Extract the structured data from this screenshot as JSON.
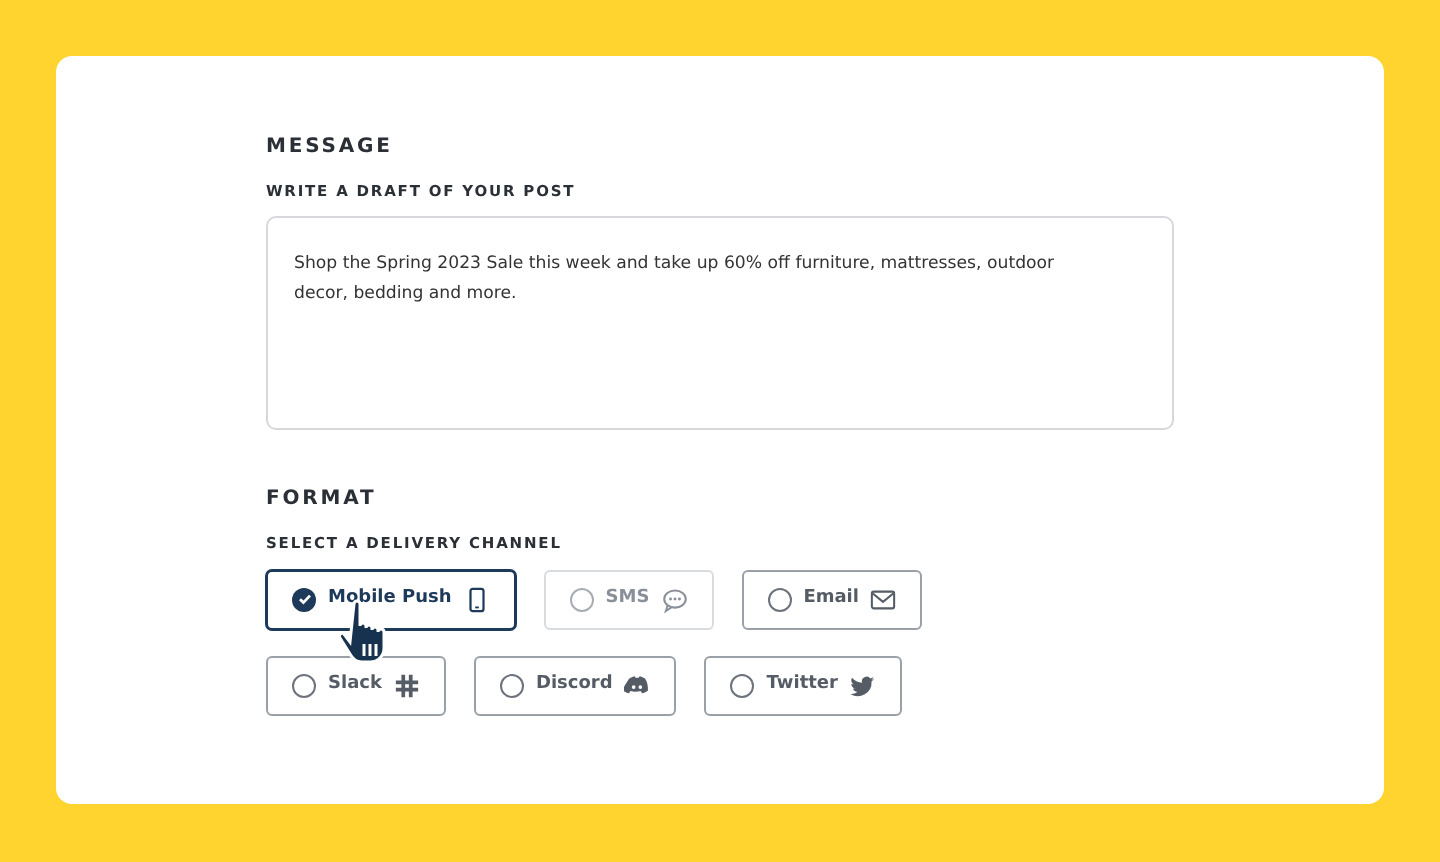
{
  "message": {
    "heading": "MESSAGE",
    "label": "WRITE A DRAFT OF YOUR POST",
    "value": "Shop the Spring 2023 Sale this week and take up 60% off furniture, mattresses, outdoor\ndecor, bedding and more."
  },
  "format": {
    "heading": "FORMAT",
    "label": "SELECT A DELIVERY CHANNEL",
    "channels": [
      {
        "label": "Mobile Push",
        "selected": true,
        "disabled": false
      },
      {
        "label": "SMS",
        "selected": false,
        "disabled": true
      },
      {
        "label": "Email",
        "selected": false,
        "disabled": false
      },
      {
        "label": "Slack",
        "selected": false,
        "disabled": false
      },
      {
        "label": "Discord",
        "selected": false,
        "disabled": false
      },
      {
        "label": "Twitter",
        "selected": false,
        "disabled": false
      }
    ]
  }
}
